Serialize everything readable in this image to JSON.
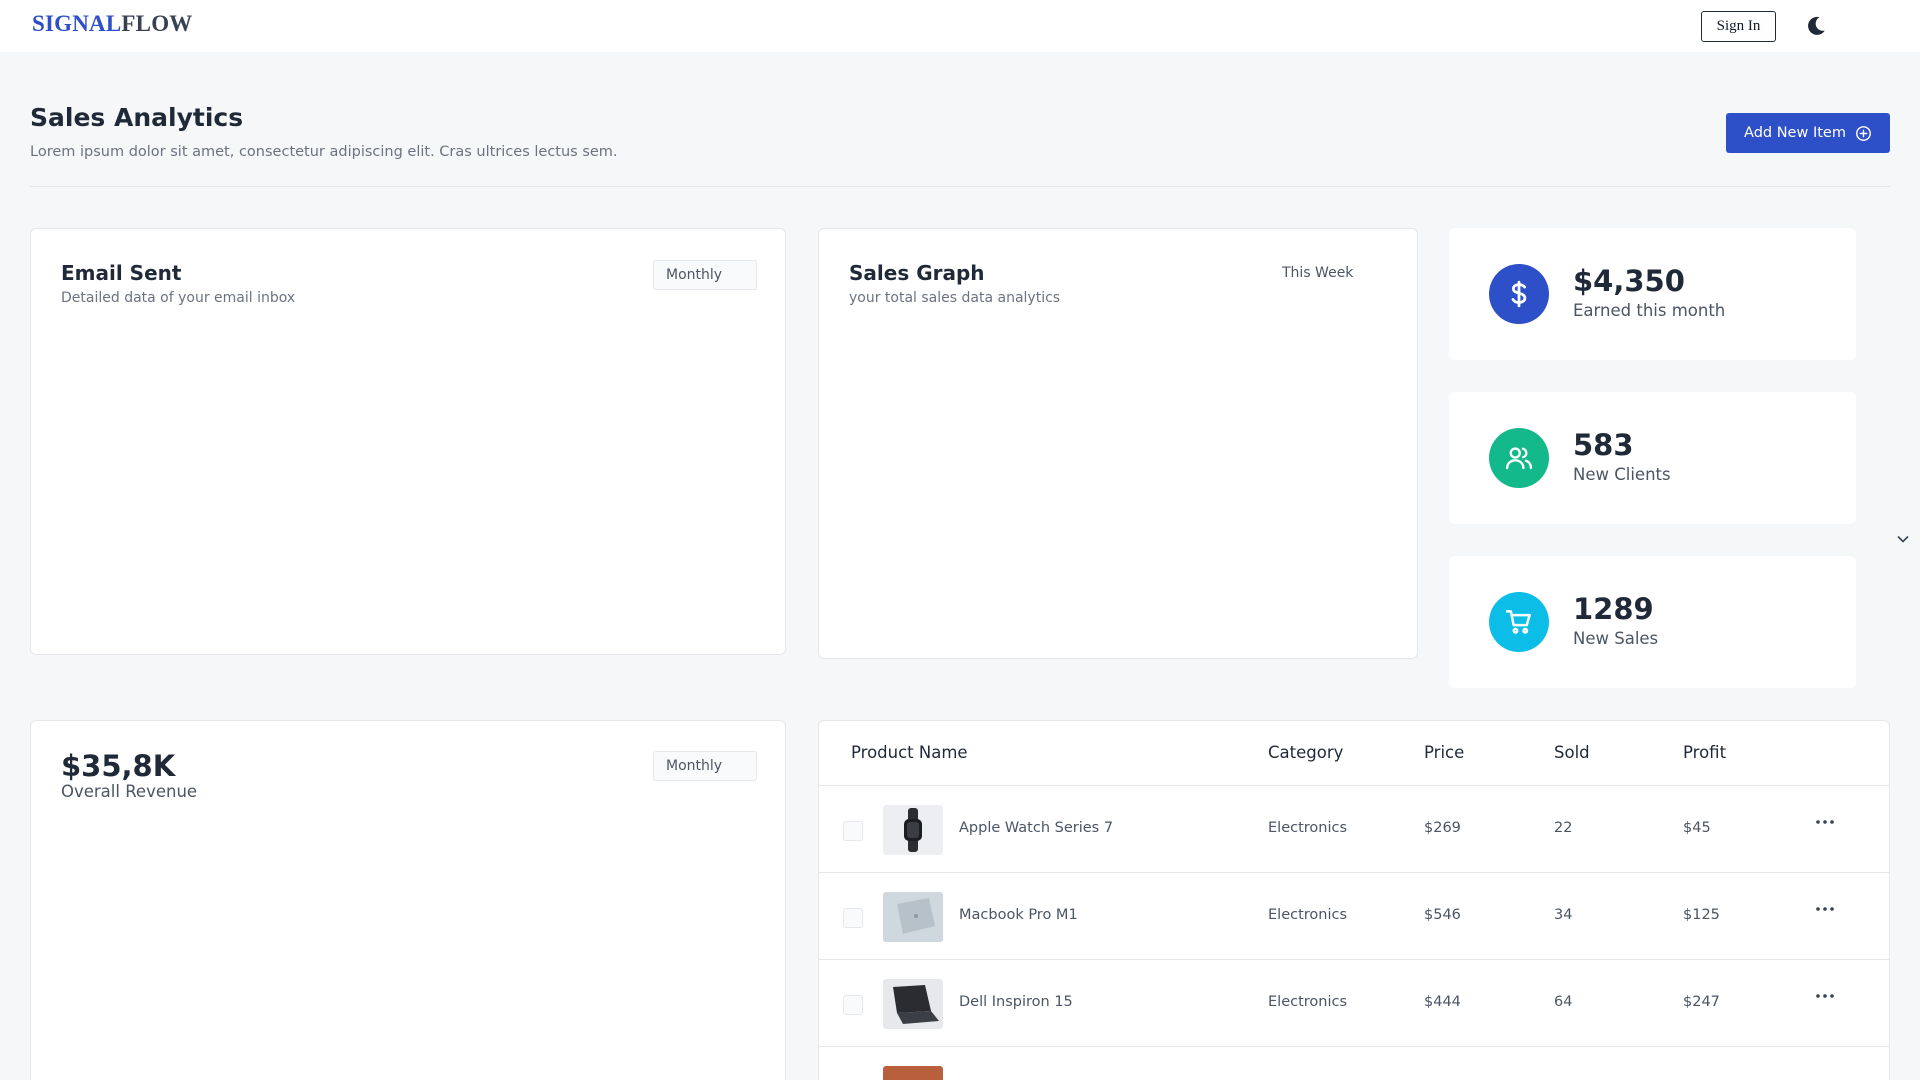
{
  "header": {
    "logo_part1": "SIGNAL",
    "logo_part2": "FLOW",
    "signin_label": "Sign In"
  },
  "page": {
    "title": "Sales Analytics",
    "subtitle": "Lorem ipsum dolor sit amet, consectetur adipiscing elit. Cras ultrices lectus sem.",
    "add_button_label": "Add New Item"
  },
  "email_card": {
    "title": "Email Sent",
    "subtitle": "Detailed data of your email inbox",
    "period": "Monthly"
  },
  "sales_card": {
    "title": "Sales Graph",
    "subtitle": "your total sales data analytics",
    "period": "This Week"
  },
  "stats": [
    {
      "value": "$4,350",
      "label": "Earned this month",
      "icon": "dollar-icon",
      "color": "#2d4fc7"
    },
    {
      "value": "583",
      "label": "New Clients",
      "icon": "users-icon",
      "color": "#13b98a"
    },
    {
      "value": "1289",
      "label": "New Sales",
      "icon": "cart-icon",
      "color": "#0cbde8"
    }
  ],
  "revenue_card": {
    "value": "$35,8K",
    "label": "Overall Revenue",
    "period": "Monthly"
  },
  "table": {
    "columns": [
      "Product Name",
      "Category",
      "Price",
      "Sold",
      "Profit"
    ],
    "rows": [
      {
        "name": "Apple Watch Series 7",
        "category": "Electronics",
        "price": "$269",
        "sold": "22",
        "profit": "$45"
      },
      {
        "name": "Macbook Pro M1",
        "category": "Electronics",
        "price": "$546",
        "sold": "34",
        "profit": "$125"
      },
      {
        "name": "Dell Inspiron 15",
        "category": "Electronics",
        "price": "$444",
        "sold": "64",
        "profit": "$247"
      }
    ]
  },
  "colors": {
    "brand": "#2d4fc7",
    "green": "#13b98a",
    "cyan": "#0cbde8"
  }
}
